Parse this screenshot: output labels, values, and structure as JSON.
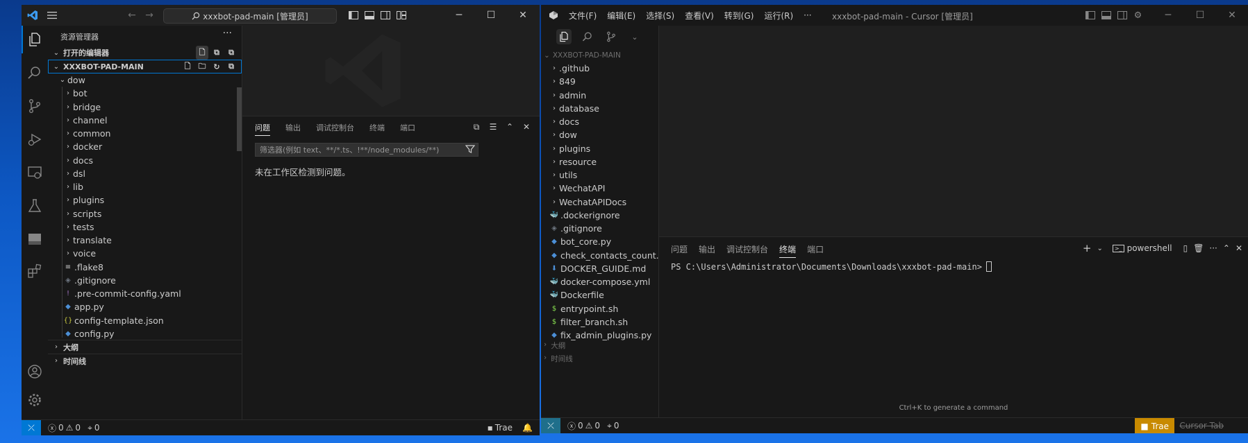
{
  "windowA": {
    "search_label": "xxxbot-pad-main [管理员]",
    "explorer_title": "资源管理器",
    "open_editors_label": "打开的编辑器",
    "root_label": "XXXBOT-PAD-MAIN",
    "tree": [
      {
        "label": "dow",
        "kind": "folder-open",
        "depth": 0
      },
      {
        "label": "bot",
        "kind": "folder",
        "depth": 1
      },
      {
        "label": "bridge",
        "kind": "folder",
        "depth": 1
      },
      {
        "label": "channel",
        "kind": "folder",
        "depth": 1
      },
      {
        "label": "common",
        "kind": "folder",
        "depth": 1
      },
      {
        "label": "docker",
        "kind": "folder",
        "depth": 1
      },
      {
        "label": "docs",
        "kind": "folder",
        "depth": 1
      },
      {
        "label": "dsl",
        "kind": "folder",
        "depth": 1
      },
      {
        "label": "lib",
        "kind": "folder",
        "depth": 1
      },
      {
        "label": "plugins",
        "kind": "folder",
        "depth": 1
      },
      {
        "label": "scripts",
        "kind": "folder",
        "depth": 1
      },
      {
        "label": "tests",
        "kind": "folder",
        "depth": 1
      },
      {
        "label": "translate",
        "kind": "folder",
        "depth": 1
      },
      {
        "label": "voice",
        "kind": "folder",
        "depth": 1
      },
      {
        "label": ".flake8",
        "kind": "file-lines",
        "depth": 1
      },
      {
        "label": ".gitignore",
        "kind": "file-git",
        "depth": 1
      },
      {
        "label": ".pre-commit-config.yaml",
        "kind": "file-excl",
        "depth": 1
      },
      {
        "label": "app.py",
        "kind": "file-py",
        "depth": 1
      },
      {
        "label": "config-template.json",
        "kind": "file-json",
        "depth": 1
      },
      {
        "label": "config.py",
        "kind": "file-py",
        "depth": 1
      }
    ],
    "outline_label": "大纲",
    "timeline_label": "时间线",
    "panel_tabs": [
      "问题",
      "输出",
      "调试控制台",
      "终端",
      "端口"
    ],
    "panel_active_tab": 0,
    "filter_placeholder": "筛选器(例如 text、**/*.ts、!**/node_modules/**)",
    "problems_message": "未在工作区检测到问题。",
    "status": {
      "errors": "0",
      "warnings": "0",
      "ports": "0",
      "trae": "Trae"
    }
  },
  "windowB": {
    "menu": [
      "文件(F)",
      "编辑(E)",
      "选择(S)",
      "查看(V)",
      "转到(G)",
      "运行(R)",
      "···"
    ],
    "title": "xxxbot-pad-main - Cursor [管理员]",
    "root_label": "XXXBOT-PAD-MAIN",
    "tree": [
      {
        "label": ".github",
        "kind": "folder"
      },
      {
        "label": "849",
        "kind": "folder"
      },
      {
        "label": "admin",
        "kind": "folder"
      },
      {
        "label": "database",
        "kind": "folder"
      },
      {
        "label": "docs",
        "kind": "folder"
      },
      {
        "label": "dow",
        "kind": "folder"
      },
      {
        "label": "plugins",
        "kind": "folder"
      },
      {
        "label": "resource",
        "kind": "folder"
      },
      {
        "label": "utils",
        "kind": "folder"
      },
      {
        "label": "WechatAPI",
        "kind": "folder"
      },
      {
        "label": "WechatAPIDocs",
        "kind": "folder"
      },
      {
        "label": ".dockerignore",
        "kind": "file-docker-gray"
      },
      {
        "label": ".gitignore",
        "kind": "file-git"
      },
      {
        "label": "bot_core.py",
        "kind": "file-py"
      },
      {
        "label": "check_contacts_count...",
        "kind": "file-py"
      },
      {
        "label": "DOCKER_GUIDE.md",
        "kind": "file-md"
      },
      {
        "label": "docker-compose.yml",
        "kind": "file-docker-red"
      },
      {
        "label": "Dockerfile",
        "kind": "file-docker"
      },
      {
        "label": "entrypoint.sh",
        "kind": "file-sh"
      },
      {
        "label": "filter_branch.sh",
        "kind": "file-sh"
      },
      {
        "label": "fix_admin_plugins.py",
        "kind": "file-py"
      }
    ],
    "outline_label": "大纲",
    "timeline_label": "时间线",
    "panel_tabs": [
      "问题",
      "输出",
      "调试控制台",
      "终端",
      "端口"
    ],
    "panel_active_tab": 3,
    "shell_label": "powershell",
    "prompt": "PS C:\\Users\\Administrator\\Documents\\Downloads\\xxxbot-pad-main>",
    "hint": "Ctrl+K to generate a command",
    "status": {
      "errors": "0",
      "warnings": "0",
      "ports": "0",
      "trae": "Trae",
      "cursor_tab": "Cursor Tab"
    }
  },
  "colors": {
    "accent": "#0078d4",
    "trae": "#c88a00",
    "python": "#4c8fd6",
    "json": "#cbcb41",
    "sh": "#89e051",
    "yaml_excl": "#a074c4",
    "docker": "#1d91e6",
    "docker_red": "#e0475b",
    "md": "#4c8fd6"
  }
}
